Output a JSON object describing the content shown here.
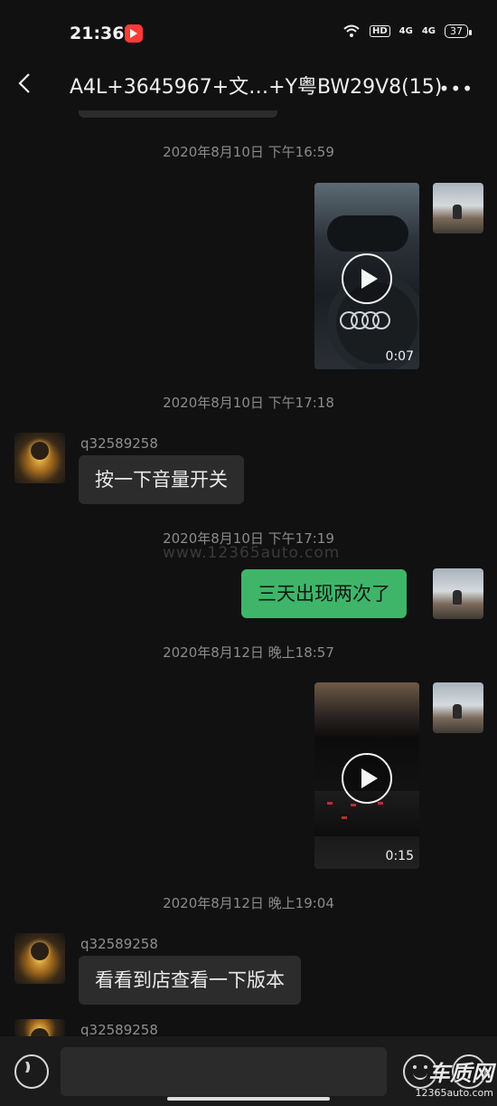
{
  "status_bar": {
    "time": "21:36",
    "hd_label": "HD",
    "signal1": "4G",
    "signal2": "4G",
    "battery": "37"
  },
  "header": {
    "title": "A4L+3645967+文…+Y粤BW29V8(15)",
    "more_label": "•••"
  },
  "messages": [
    {
      "type": "timestamp",
      "text": "2020年8月10日 下午16:59"
    },
    {
      "type": "video",
      "side": "out",
      "duration": "0:07"
    },
    {
      "type": "timestamp",
      "text": "2020年8月10日 下午17:18"
    },
    {
      "type": "text",
      "side": "in",
      "sender": "q32589258",
      "text": "按一下音量开关"
    },
    {
      "type": "timestamp",
      "text": "2020年8月10日 下午17:19"
    },
    {
      "type": "text",
      "side": "out",
      "text": "三天出现两次了"
    },
    {
      "type": "timestamp",
      "text": "2020年8月12日 晚上18:57"
    },
    {
      "type": "video",
      "side": "out",
      "duration": "0:15"
    },
    {
      "type": "timestamp",
      "text": "2020年8月12日 晚上19:04"
    },
    {
      "type": "text",
      "side": "in",
      "sender": "q32589258",
      "text": "看看到店查看一下版本"
    },
    {
      "type": "text",
      "side": "in",
      "sender": "q32589258",
      "text": ""
    }
  ],
  "watermark": "www.12365auto.com",
  "logo": {
    "cn": "车质网",
    "url": "12365auto.com"
  },
  "colors": {
    "background": "#111111",
    "out_bubble": "#3fb56a",
    "in_bubble": "#2c2c2c"
  }
}
